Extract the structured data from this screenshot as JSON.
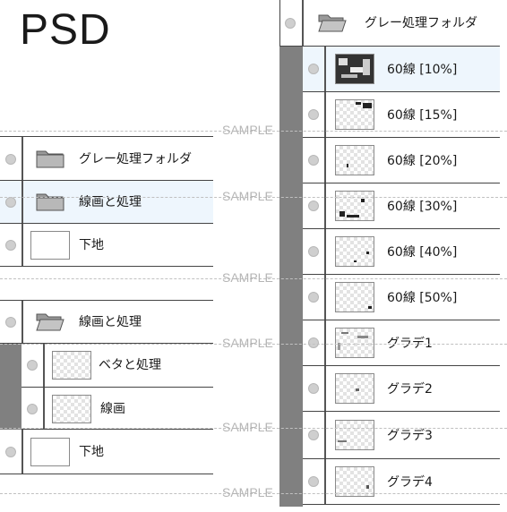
{
  "title": "PSD",
  "left_panel_top": {
    "rows": [
      {
        "label": "グレー処理フォルダ",
        "icon": "folder-closed-icon"
      },
      {
        "label": "線画と処理",
        "icon": "folder-closed-icon"
      },
      {
        "label": "下地",
        "icon": "layer-thumbnail"
      }
    ]
  },
  "left_panel_bottom": {
    "group": {
      "label": "線画と処理",
      "icon": "folder-open-icon"
    },
    "children": [
      {
        "label": "ベタと処理"
      },
      {
        "label": "線画"
      }
    ],
    "base": {
      "label": "下地"
    }
  },
  "right_panel": {
    "group": {
      "label": "グレー処理フォルダ",
      "icon": "folder-open-icon"
    },
    "children": [
      {
        "label": "60線 [10%]"
      },
      {
        "label": "60線 [15%]"
      },
      {
        "label": "60線 [20%]"
      },
      {
        "label": "60線 [30%]"
      },
      {
        "label": "60線 [40%]"
      },
      {
        "label": "60線 [50%]"
      },
      {
        "label": "グラデ1"
      },
      {
        "label": "グラデ2"
      },
      {
        "label": "グラデ3"
      },
      {
        "label": "グラデ4"
      }
    ]
  },
  "watermark": "SAMPLE",
  "colors": {
    "selected_row": "#eef6fd",
    "gutter": "#808080",
    "border": "#444444"
  }
}
